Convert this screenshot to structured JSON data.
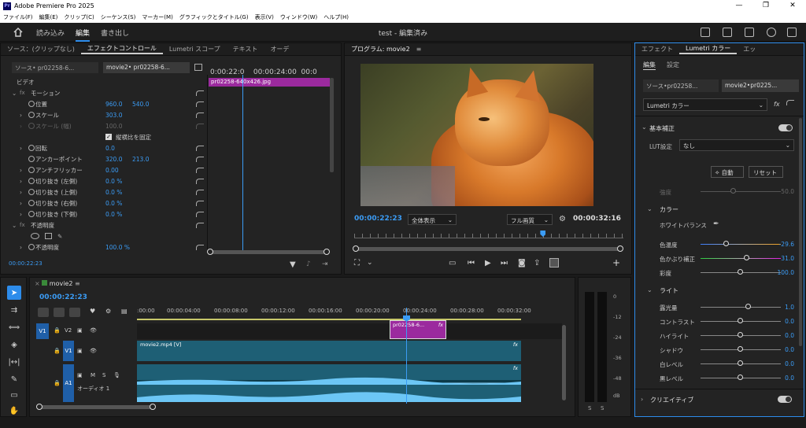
{
  "window": {
    "title": "Adobe Premiere Pro 2025",
    "minimize": "—",
    "maximize": "❐",
    "close": "✕"
  },
  "menu": [
    "ファイル(F)",
    "編集(E)",
    "クリップ(C)",
    "シーケンス(S)",
    "マーカー(M)",
    "グラフィックとタイトル(G)",
    "表示(V)",
    "ウィンドウ(W)",
    "ヘルプ(H)"
  ],
  "workspace": {
    "import": "読み込み",
    "edit": "編集",
    "export": "書き出し",
    "project_title": "test - 編集済み"
  },
  "effect_controls": {
    "tabs": [
      "ソース：(クリップなし)",
      "エフェクトコントロール",
      "Lumetri スコープ",
      "テキスト",
      "オーデ"
    ],
    "source_clip": "ソース• pr02258-6...",
    "active_clip": "movie2• pr02258-6...",
    "timecode_ruler": "0:00:22:0",
    "ruler_mid": "00:00:24:00",
    "ruler_end": "00:0",
    "clip_bar": "pr02258-640x426.jpg",
    "video_header": "ビデオ",
    "motion": "モーション",
    "position": {
      "label": "位置",
      "x": "960.0",
      "y": "540.0"
    },
    "scale": {
      "label": "スケール",
      "value": "303.0"
    },
    "scale_width": {
      "label": "スケール (幅)",
      "value": "100.0"
    },
    "uniform": "縦横比を固定",
    "rotation": {
      "label": "回転",
      "value": "0.0"
    },
    "anchor": {
      "label": "アンカーポイント",
      "x": "320.0",
      "y": "213.0"
    },
    "flicker": {
      "label": "アンチフリッカー",
      "value": "0.00"
    },
    "crop_left": {
      "label": "切り抜き (左側)",
      "value": "0.0 %"
    },
    "crop_top": {
      "label": "切り抜き (上側)",
      "value": "0.0 %"
    },
    "crop_right": {
      "label": "切り抜き (右側)",
      "value": "0.0 %"
    },
    "crop_bottom": {
      "label": "切り抜き (下側)",
      "value": "0.0 %"
    },
    "opacity_header": "不透明度",
    "opacity": {
      "label": "不透明度",
      "value": "100.0 %"
    },
    "timecode": "00:00:22:23",
    "fx": "fx"
  },
  "program": {
    "title": "プログラム: movie2",
    "timecode": "00:00:22:23",
    "zoom": "全体表示",
    "quality": "フル画質",
    "duration": "00:00:32:16",
    "playhead_fraction": 0.7
  },
  "timeline": {
    "sequence": "movie2",
    "timecode": "00:00:22:23",
    "ruler": [
      ":00:00",
      "00:00:04:00",
      "00:00:08:00",
      "00:00:12:00",
      "00:00:16:00",
      "00:00:20:00",
      "00:00:24:00",
      "00:00:28:00",
      "00:00:32:00"
    ],
    "tracks": {
      "v2": "V2",
      "v1": "V1",
      "a1": "A1",
      "src_v1": "V1",
      "m": "M",
      "s": "S"
    },
    "clip_v2": "pr02258-6...",
    "clip_v1": "movie2.mp4 [V]",
    "audio_name": "オーディオ 1",
    "fx": "fx"
  },
  "meter": {
    "scale": [
      "0",
      "-12",
      "-24",
      "-36",
      "-48",
      "dB"
    ],
    "solo_l": "S",
    "solo_r": "S"
  },
  "lumetri": {
    "tabs": [
      "エフェクト",
      "Lumetri カラー",
      "エッ"
    ],
    "subtabs": [
      "編集",
      "設定"
    ],
    "source_clip": "ソース•pr02258...",
    "active_clip": "movie2•pr0225...",
    "effect_select": "Lumetri カラー",
    "basic": "基本補正",
    "lut_label": "LUT設定",
    "lut_value": "なし",
    "auto": "自動",
    "reset": "リセット",
    "intensity": {
      "label": "強度",
      "value": "50.0"
    },
    "color_header": "カラー",
    "wb": "ホワイトバランス",
    "temperature": {
      "label": "色温度",
      "value": "-29.6",
      "fraction": 0.32
    },
    "tint": {
      "label": "色かぶり補正",
      "value": "31.0",
      "fraction": 0.58
    },
    "saturation": {
      "label": "彩度",
      "value": "100.0",
      "fraction": 0.5
    },
    "light_header": "ライト",
    "exposure": {
      "label": "露光量",
      "value": "1.0",
      "fraction": 0.6
    },
    "contrast": {
      "label": "コントラスト",
      "value": "0.0",
      "fraction": 0.5
    },
    "highlights": {
      "label": "ハイライト",
      "value": "0.0",
      "fraction": 0.5
    },
    "shadows": {
      "label": "シャドウ",
      "value": "0.0",
      "fraction": 0.5
    },
    "whites": {
      "label": "白レベル",
      "value": "0.0",
      "fraction": 0.5
    },
    "blacks": {
      "label": "黒レベル",
      "value": "0.0",
      "fraction": 0.5
    },
    "creative": "クリエイティブ"
  }
}
